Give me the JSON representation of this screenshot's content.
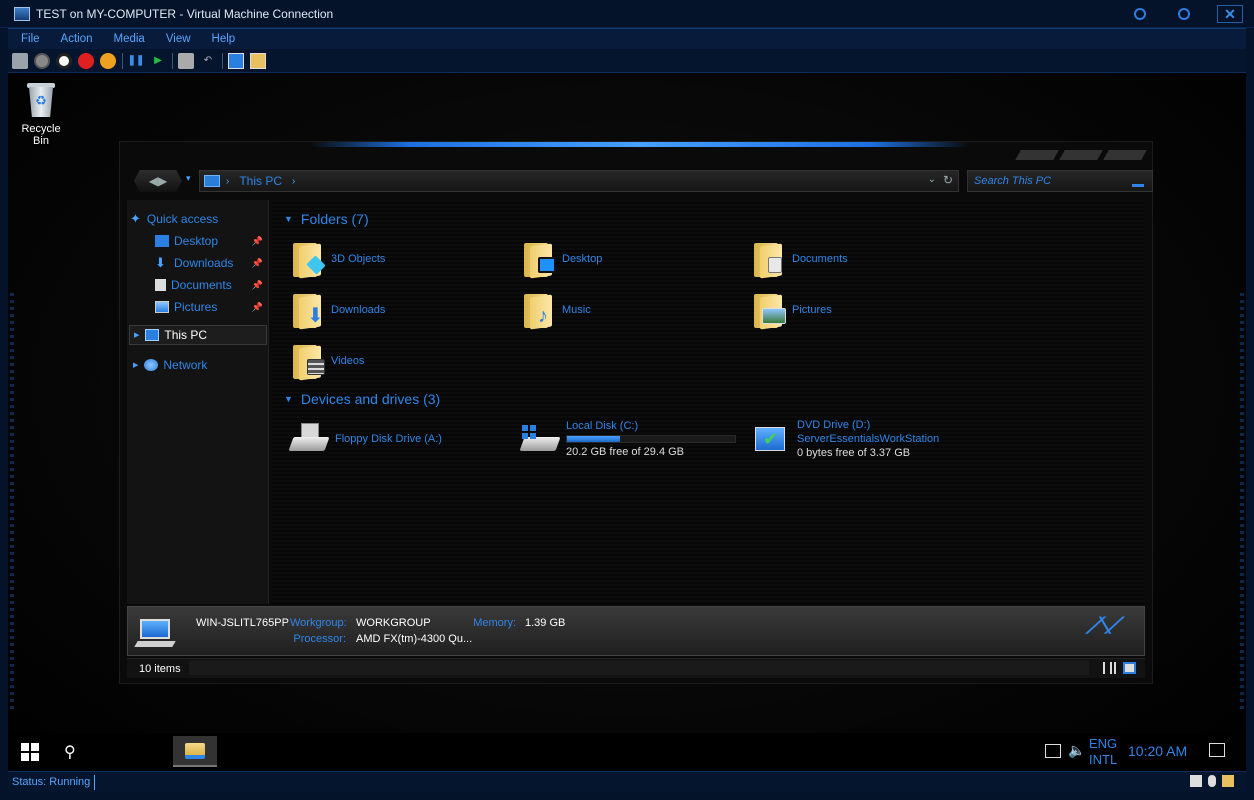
{
  "vm_window": {
    "title": "TEST on MY-COMPUTER - Virtual Machine Connection",
    "menu": [
      "File",
      "Action",
      "Media",
      "View",
      "Help"
    ],
    "status": "Status: Running",
    "close_glyph": "✕"
  },
  "desktop": {
    "recycle_bin_label": "Recycle Bin"
  },
  "explorer": {
    "address": "This PC",
    "search_placeholder": "Search This PC",
    "nav": {
      "quick_access": "Quick access",
      "quick_items": [
        {
          "label": "Desktop",
          "icon": "desktop-icon"
        },
        {
          "label": "Downloads",
          "icon": "download-icon"
        },
        {
          "label": "Documents",
          "icon": "document-icon"
        },
        {
          "label": "Pictures",
          "icon": "picture-icon"
        }
      ],
      "this_pc": "This PC",
      "network": "Network"
    },
    "folders_header": "Folders (7)",
    "folders": [
      {
        "label": "3D Objects",
        "badge_color": "#3ec5f0"
      },
      {
        "label": "Desktop",
        "badge_color": "#1e90ff"
      },
      {
        "label": "Documents",
        "badge_color": "#e8e8e8"
      },
      {
        "label": "Downloads",
        "badge_color": "#2b7fe0"
      },
      {
        "label": "Music",
        "badge_color": "#2b7fe0"
      },
      {
        "label": "Pictures",
        "badge_color": "#8fc7ff"
      },
      {
        "label": "Videos",
        "badge_color": "#555555"
      }
    ],
    "devices_header": "Devices and drives (3)",
    "drives": [
      {
        "name": "Floppy Disk Drive (A:)",
        "sub": "",
        "sub2": ""
      },
      {
        "name": "Local Disk (C:)",
        "free": "20.2 GB free of 29.4 GB",
        "used_fraction": 0.313
      },
      {
        "name": "DVD Drive (D:)",
        "sub": "ServerEssentialsWorkStation",
        "free": "0 bytes free of 3.37 GB"
      }
    ],
    "details": {
      "pc_name": "WIN-JSLITL765PP",
      "workgroup_key": "Workgroup:",
      "workgroup_val": "WORKGROUP",
      "memory_key": "Memory:",
      "memory_val": "1.39 GB",
      "processor_key": "Processor:",
      "processor_val": "AMD FX(tm)-4300 Qu..."
    },
    "item_count": "10 items"
  },
  "taskbar": {
    "lang_line1": "ENG",
    "lang_line2": "INTL",
    "time": "10:20 AM"
  }
}
